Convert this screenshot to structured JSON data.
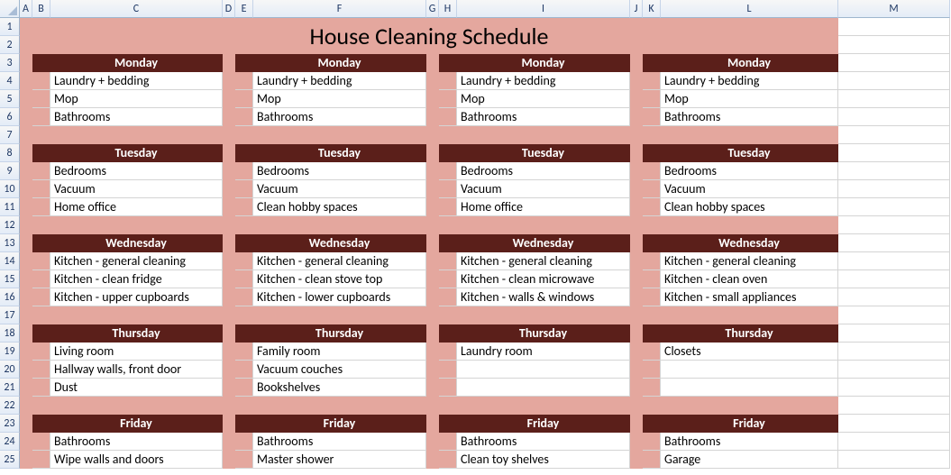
{
  "title": "House Cleaning Schedule",
  "columns": [
    "A",
    "B",
    "C",
    "D",
    "E",
    "F",
    "G",
    "H",
    "I",
    "J",
    "K",
    "L",
    "M"
  ],
  "rowCount": 25,
  "weeks": [
    {
      "days": [
        {
          "name": "Monday",
          "tasks": [
            "Laundry + bedding",
            "Mop",
            "Bathrooms"
          ]
        },
        {
          "name": "Tuesday",
          "tasks": [
            "Bedrooms",
            "Vacuum",
            "Home office"
          ]
        },
        {
          "name": "Wednesday",
          "tasks": [
            "Kitchen - general cleaning",
            "Kitchen - clean fridge",
            "Kitchen - upper cupboards"
          ]
        },
        {
          "name": "Thursday",
          "tasks": [
            "Living room",
            "Hallway walls, front door",
            "Dust"
          ]
        },
        {
          "name": "Friday",
          "tasks": [
            "Bathrooms",
            "Wipe walls and doors"
          ]
        }
      ]
    },
    {
      "days": [
        {
          "name": "Monday",
          "tasks": [
            "Laundry + bedding",
            "Mop",
            "Bathrooms"
          ]
        },
        {
          "name": "Tuesday",
          "tasks": [
            "Bedrooms",
            "Vacuum",
            "Clean hobby spaces"
          ]
        },
        {
          "name": "Wednesday",
          "tasks": [
            "Kitchen - general cleaning",
            "Kitchen - clean stove top",
            "Kitchen - lower cupboards"
          ]
        },
        {
          "name": "Thursday",
          "tasks": [
            "Family room",
            "Vacuum couches",
            "Bookshelves"
          ]
        },
        {
          "name": "Friday",
          "tasks": [
            "Bathrooms",
            "Master shower"
          ]
        }
      ]
    },
    {
      "days": [
        {
          "name": "Monday",
          "tasks": [
            "Laundry + bedding",
            "Mop",
            "Bathrooms"
          ]
        },
        {
          "name": "Tuesday",
          "tasks": [
            "Bedrooms",
            "Vacuum",
            "Home office"
          ]
        },
        {
          "name": "Wednesday",
          "tasks": [
            "Kitchen - general cleaning",
            "Kitchen - clean microwave",
            "Kitchen - walls & windows"
          ]
        },
        {
          "name": "Thursday",
          "tasks": [
            "Laundry room",
            "",
            ""
          ]
        },
        {
          "name": "Friday",
          "tasks": [
            "Bathrooms",
            "Clean toy shelves"
          ]
        }
      ]
    },
    {
      "days": [
        {
          "name": "Monday",
          "tasks": [
            "Laundry + bedding",
            "Mop",
            "Bathrooms"
          ]
        },
        {
          "name": "Tuesday",
          "tasks": [
            "Bedrooms",
            "Vacuum",
            "Clean hobby spaces"
          ]
        },
        {
          "name": "Wednesday",
          "tasks": [
            "Kitchen - general cleaning",
            "Kitchen - clean oven",
            "Kitchen - small appliances"
          ]
        },
        {
          "name": "Thursday",
          "tasks": [
            "Closets",
            "",
            ""
          ]
        },
        {
          "name": "Friday",
          "tasks": [
            "Bathrooms",
            "Garage"
          ]
        }
      ]
    }
  ]
}
